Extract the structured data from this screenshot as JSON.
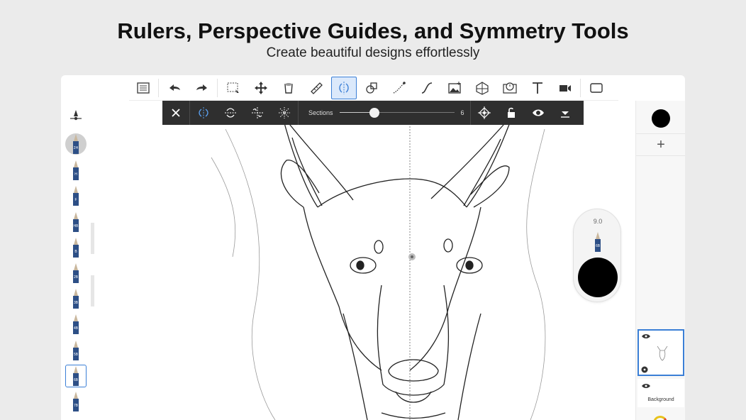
{
  "promo": {
    "headline": "Rulers, Perspective Guides, and Symmetry Tools",
    "subline": "Create beautiful designs effortlessly"
  },
  "toolbar": {
    "tools": [
      "list-icon",
      "undo-icon",
      "redo-icon",
      "selection-icon",
      "transform-icon",
      "fill-icon",
      "ruler-icon",
      "symmetry-icon",
      "shape-icon",
      "stroke-icon",
      "curve-icon",
      "image-icon",
      "perspective-icon",
      "time-lapse-icon",
      "text-icon",
      "video-icon",
      "fullscreen-icon"
    ],
    "active": "symmetry-icon"
  },
  "symmetry_bar": {
    "sections_label": "Sections",
    "sections_value": "6",
    "sections_fraction": 0.3
  },
  "brushes": [
    {
      "label": "2H",
      "selected": "gray"
    },
    {
      "label": "H"
    },
    {
      "label": "F"
    },
    {
      "label": "HB"
    },
    {
      "label": "B"
    },
    {
      "label": "2B"
    },
    {
      "label": "3B"
    },
    {
      "label": "4B"
    },
    {
      "label": "5B"
    },
    {
      "label": "6B",
      "selected": "blue"
    },
    {
      "label": "7B"
    }
  ],
  "puck": {
    "brush_size": "9.0",
    "brush_label": "6B"
  },
  "layers": {
    "background_label": "Background"
  },
  "colors": {
    "accent": "#3b7fd6",
    "current_color": "#000000",
    "symmetry_bar_bg": "#2f2f2f"
  }
}
